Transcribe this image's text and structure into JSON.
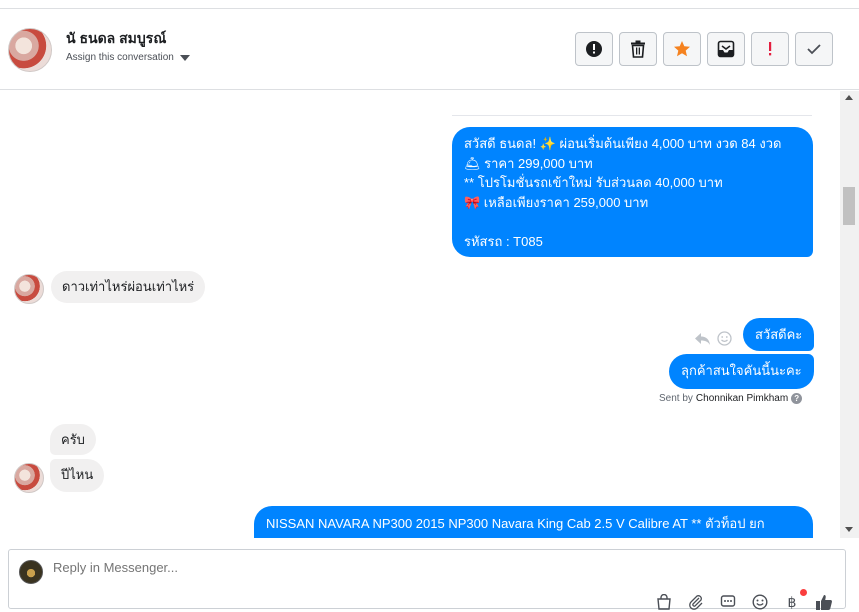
{
  "header": {
    "contact_name": "นั ธนดล สมบูรณ์",
    "assign_label": "Assign this conversation"
  },
  "actions": [
    {
      "name": "spam-button",
      "icon": "alert-circle-icon"
    },
    {
      "name": "delete-button",
      "icon": "trash-icon"
    },
    {
      "name": "star-button",
      "icon": "star-icon",
      "color": "#f5821f"
    },
    {
      "name": "archive-button",
      "icon": "archive-icon"
    },
    {
      "name": "mark-important-button",
      "icon": "exclamation-icon",
      "color": "#e41e3f"
    },
    {
      "name": "mark-done-button",
      "icon": "check-icon"
    }
  ],
  "messages": {
    "m1": {
      "lines": [
        "สวัสดี ธนดล! ✨  ผ่อนเริ่มต้นเพียง 4,000 บาท งวด 84 งวด",
        "🛎 ราคา 299,000 บาท",
        "** โปรโมชั่นรถเข้าใหม่ รับส่วนลด 40,000 บาท",
        "🎀  เหลือเพียงราคา 259,000 บาท",
        "",
        " รหัสรถ : T085"
      ]
    },
    "m2": "ดาวเท่าไหร่ผ่อนเท่าไหร่",
    "m3": "สวัสดีคะ",
    "m4": "ลุกค้าสนใจคันนี้นะคะ",
    "sent_by_prefix": "Sent by",
    "sent_by_name": "Chonnikan Pimkham",
    "m5": "ครับ",
    "m6": "ปีไหน",
    "m7": "NISSAN NAVARA NP300 2015 NP300 Navara King Cab 2.5 V Calibre AT ** ตัวท็อป ยก"
  },
  "composer": {
    "placeholder": "Reply in Messenger...",
    "icons": [
      "shop-icon",
      "attachment-icon",
      "saved-reply-icon",
      "emoji-icon",
      "baht-icon",
      "like-icon"
    ]
  },
  "colors": {
    "outgoing": "#0084ff",
    "incoming": "#f1f0f0"
  }
}
